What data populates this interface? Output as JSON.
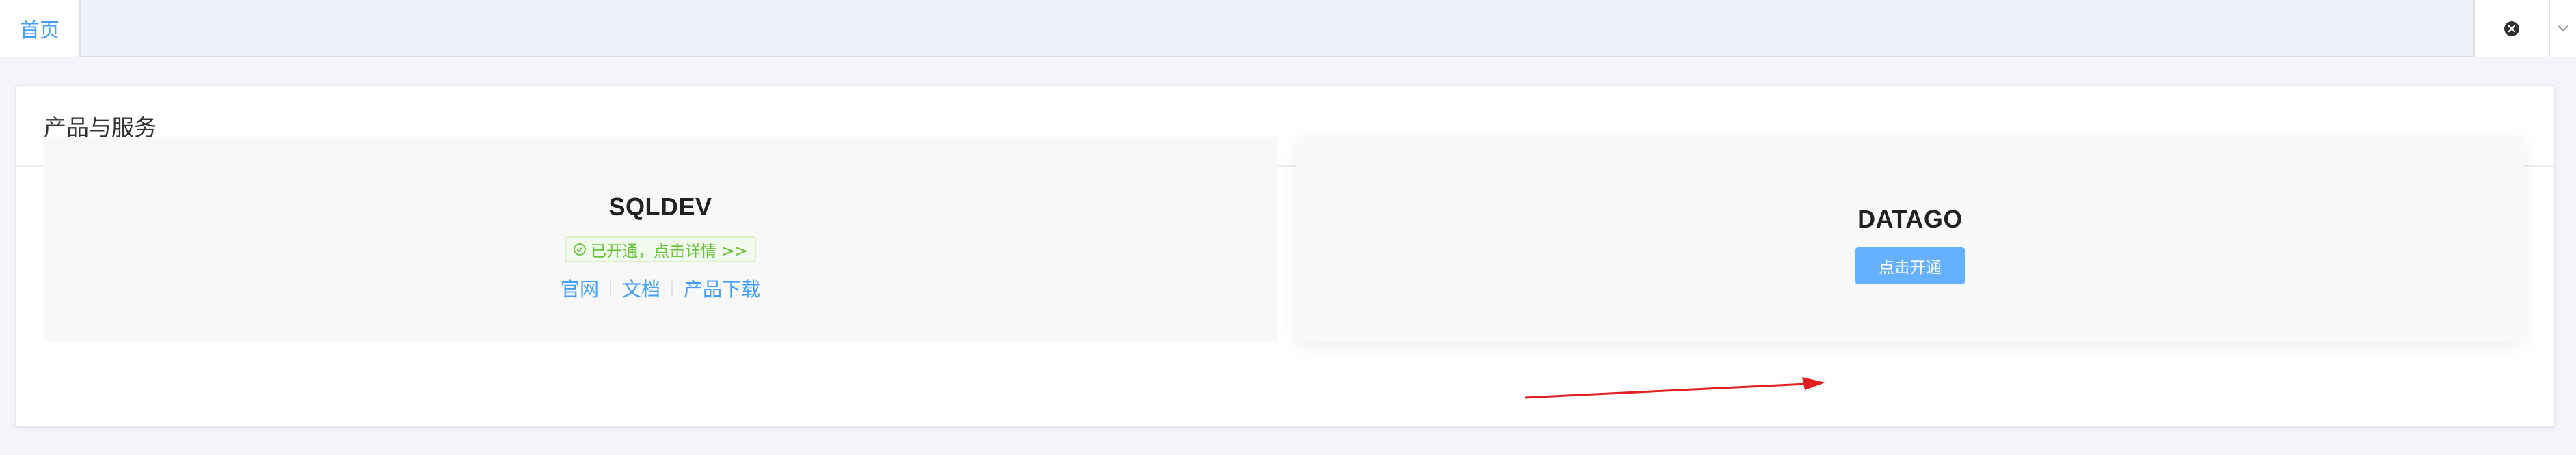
{
  "tabs": [
    {
      "label": "首页",
      "active": true
    }
  ],
  "tab_tools": {
    "close_icon": "close-circle-icon",
    "dropdown_icon": "chevron-down-icon"
  },
  "card": {
    "title": "产品与服务"
  },
  "products": [
    {
      "name": "SQLDEV",
      "status": "已开通，点击详情 >>",
      "status_icon": "check-circle-icon",
      "links": [
        "官网",
        "文档",
        "产品下载"
      ]
    },
    {
      "name": "DATAGO",
      "action_label": "点击开通"
    }
  ],
  "colors": {
    "accent": "#409eff",
    "button": "#66b1ff",
    "success": "#67c23a",
    "annotation_arrow": "#e02020"
  }
}
